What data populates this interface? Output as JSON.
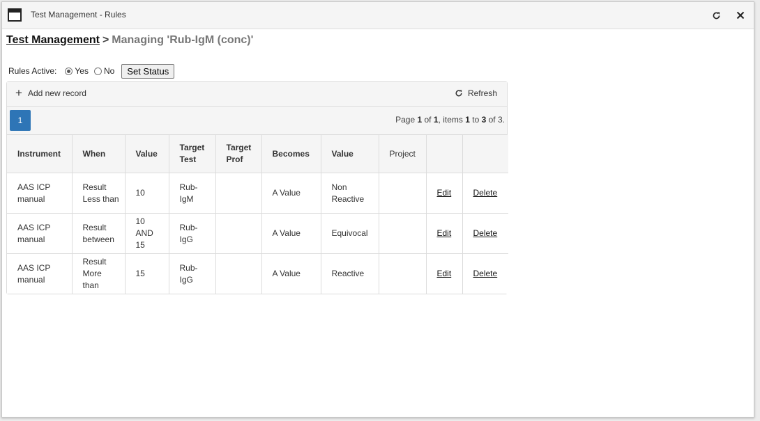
{
  "window": {
    "title": "Test Management - Rules",
    "icons": {
      "app": "window-icon",
      "refresh": "refresh-icon",
      "close": "close-icon"
    }
  },
  "breadcrumb": {
    "root": "Test Management",
    "separator": ">",
    "current": "Managing 'Rub-IgM (conc)'"
  },
  "rules_active": {
    "label": "Rules Active:",
    "yes_label": "Yes",
    "no_label": "No",
    "selected": "Yes",
    "button_label": "Set Status"
  },
  "toolbar": {
    "add_label": "Add new record",
    "refresh_label": "Refresh"
  },
  "pager": {
    "current_page": "1",
    "info_prefix": "Page ",
    "page": "1",
    "info_of": " of ",
    "total_pages": "1",
    "info_items": ", items ",
    "from": "1",
    "info_to": " to ",
    "to": "3",
    "info_of2": " of ",
    "total_items": "3",
    "info_end": "."
  },
  "table": {
    "headers": [
      "Instrument",
      "When",
      "Value",
      "Target Test",
      "Target Prof",
      "Becomes",
      "Value",
      "Project",
      "",
      ""
    ],
    "rows": [
      {
        "instrument": "AAS ICP manual",
        "when": "Result Less than",
        "value": "10",
        "target_test": "Rub-IgM",
        "target_prof": "",
        "becomes": "A Value",
        "result_value": "Non Reactive",
        "project": "",
        "edit": "Edit",
        "delete": "Delete"
      },
      {
        "instrument": "AAS ICP manual",
        "when": "Result between",
        "value": "10 AND 15",
        "target_test": "Rub-IgG",
        "target_prof": "",
        "becomes": "A Value",
        "result_value": "Equivocal",
        "project": "",
        "edit": "Edit",
        "delete": "Delete"
      },
      {
        "instrument": "AAS ICP manual",
        "when": "Result More than",
        "value": "15",
        "target_test": "Rub-IgG",
        "target_prof": "",
        "becomes": "A Value",
        "result_value": "Reactive",
        "project": "",
        "edit": "Edit",
        "delete": "Delete"
      }
    ]
  },
  "colors": {
    "accent": "#2e75b6",
    "header_bg": "#f5f5f5",
    "border": "#dcdcdc"
  }
}
